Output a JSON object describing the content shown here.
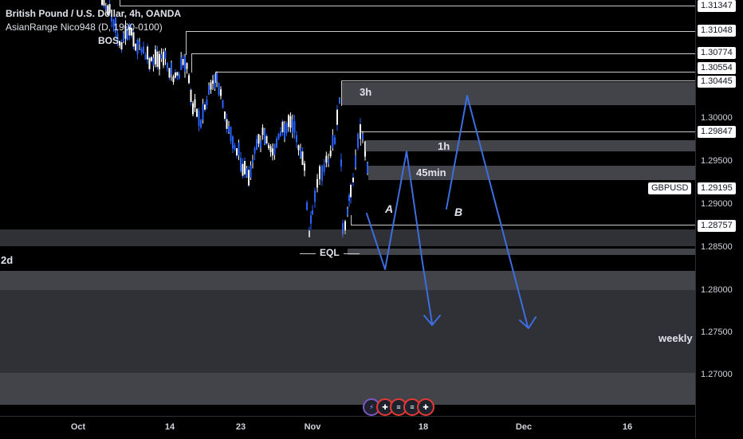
{
  "header": {
    "title": "British Pound / U.S. Dollar, 4h, OANDA",
    "indicator": "AsianRange Nico948 (D, 1900-0100)"
  },
  "annotations": {
    "bos": "BOS",
    "eql": "EQL",
    "label_a": "A",
    "label_b": "B",
    "zone_3h": "3h",
    "zone_1h": "1h",
    "zone_45min": "45min",
    "zone_2d": "2d",
    "zone_weekly": "weekly"
  },
  "price_axis": {
    "boxed": [
      "1.31347",
      "1.31048",
      "1.30774",
      "1.30554",
      "1.30445",
      "1.29847",
      "1.28757"
    ],
    "plain": [
      "1.30000",
      "1.29500",
      "1.29000",
      "1.28500",
      "1.28000",
      "1.27500",
      "1.27000"
    ],
    "symbol": "GBPUSD",
    "current": "1.29195"
  },
  "time_axis": [
    "Oct",
    "14",
    "23",
    "Nov",
    "18",
    "Dec",
    "16"
  ],
  "toolbar": {
    "icons": [
      "bolt-icon",
      "uk-flag-icon",
      "us-flag-icon",
      "us-flag-icon",
      "uk-flag-icon"
    ]
  },
  "chart_data": {
    "type": "candlestick",
    "symbol": "GBPUSD",
    "timeframe": "4h",
    "ylim": [
      1.266,
      1.3145
    ],
    "x_ticks": [
      "Oct",
      "14",
      "23",
      "Nov",
      "18",
      "Dec",
      "16"
    ],
    "levels": [
      1.31347,
      1.31048,
      1.30774,
      1.30554,
      1.30445,
      1.29847,
      1.28757
    ],
    "current_price": 1.29195,
    "colors": {
      "candle": "#ffffff",
      "candle_alt": "#2962ff",
      "arrows": "#3d6ee0",
      "zones": "#787b86"
    }
  }
}
